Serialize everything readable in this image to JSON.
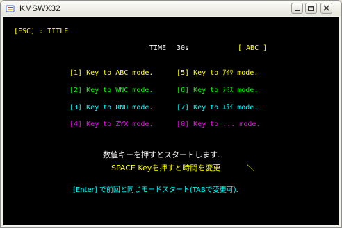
{
  "window": {
    "title": "KMSWX32",
    "icon": "app-icon",
    "buttons": [
      "minimize-icon",
      "maximize-icon",
      "close-icon"
    ]
  },
  "screen": {
    "hint_title": "[ESC] : TITLE",
    "time_label": "TIME",
    "time_value": "30s",
    "mode_indicator": "[ ABC ]",
    "menu": [
      {
        "left": "[1] Key to ABC mode.",
        "right": "[5] Key to ｱｲｳ mode.",
        "color": "#ffff00"
      },
      {
        "left": "[2] Key to WNC mode.",
        "right": "[6] Key to ﾃﾐｽ mode.",
        "color": "#00ff00"
      },
      {
        "left": "[3] Key to RND mode.",
        "right": "[7] Key to ｴﾗｲ mode.",
        "color": "#00ffff"
      },
      {
        "left": "[4] Key to ZYX mode.",
        "right": "[0] Key to ... mode.",
        "color": "#ff00ff"
      }
    ],
    "instruction_start": "数値キーを押すとスタートします.",
    "instruction_space": "SPACE Keyを押すと時間を変更",
    "spinner_char": "＼",
    "instruction_enter": "[Enter] で前回と同じモードスタート(TABで変更可)."
  },
  "colors": {
    "background": "#000000",
    "yellow": "#ffff00",
    "green": "#00ff00",
    "cyan": "#00ffff",
    "magenta": "#ff00ff",
    "white": "#ffffff"
  }
}
